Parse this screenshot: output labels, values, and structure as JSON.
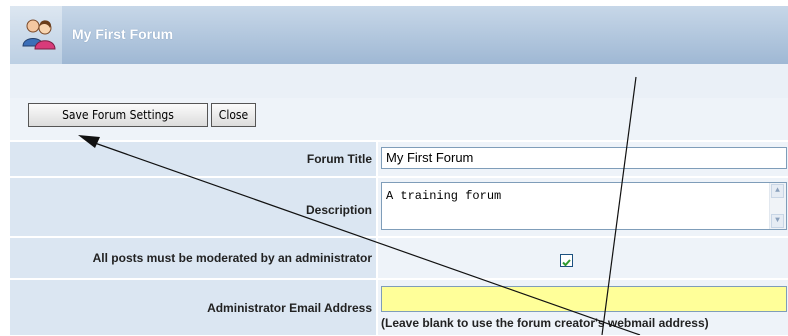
{
  "header": {
    "title": "My First Forum",
    "icon": "users-icon"
  },
  "toolbar": {
    "save_label": "Save Forum Settings",
    "close_label": "Close"
  },
  "form": {
    "forum_title_label": "Forum Title",
    "forum_title_value": "My First Forum",
    "description_label": "Description",
    "description_value": "A training forum",
    "moderation_label": "All posts must be moderated by an administrator",
    "moderation_checked": true,
    "admin_email_label": "Administrator Email Address",
    "admin_email_value": "",
    "admin_email_hint": "(Leave blank to use the forum creator's webmail address)"
  },
  "colors": {
    "header_gradient_top": "#c7d7e8",
    "header_gradient_bottom": "#9fb8d4",
    "label_bg": "#dbe6f2",
    "value_bg": "#eef3f9",
    "email_field_bg": "#ffff99",
    "checkbox_check": "#2f9b2f"
  }
}
